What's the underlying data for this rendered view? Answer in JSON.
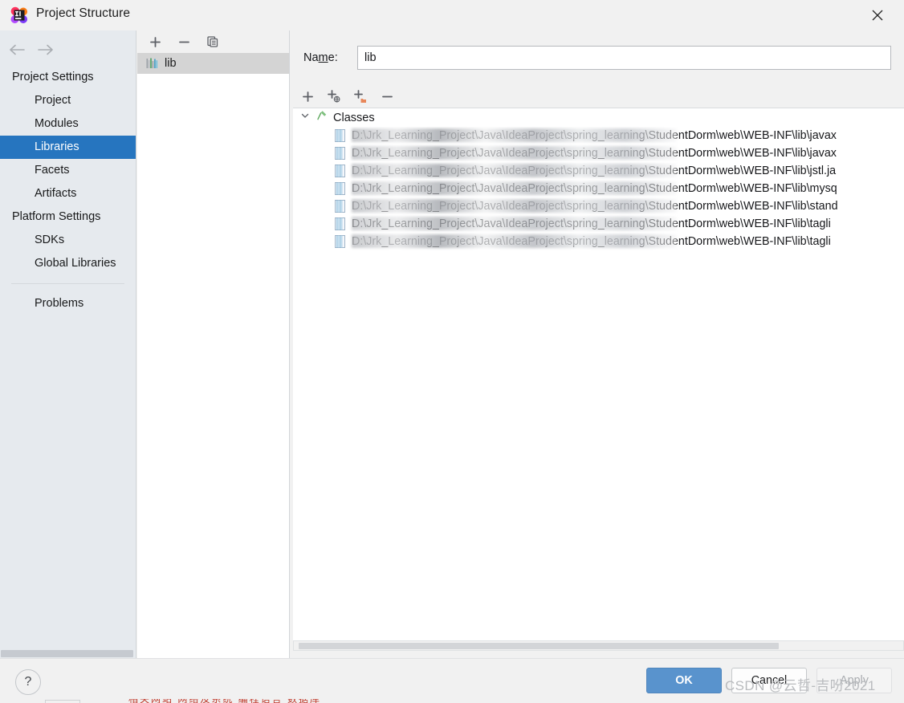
{
  "window": {
    "title": "Project Structure",
    "app_icon": "intellij-idea-logo",
    "close_icon": "close-icon"
  },
  "sidebar": {
    "back_icon": "arrow-left-icon",
    "forward_icon": "arrow-right-icon",
    "groups": [
      {
        "label": "Project Settings",
        "items": [
          {
            "label": "Project",
            "selected": false
          },
          {
            "label": "Modules",
            "selected": false
          },
          {
            "label": "Libraries",
            "selected": true
          },
          {
            "label": "Facets",
            "selected": false
          },
          {
            "label": "Artifacts",
            "selected": false
          }
        ]
      },
      {
        "label": "Platform Settings",
        "items": [
          {
            "label": "SDKs",
            "selected": false
          },
          {
            "label": "Global Libraries",
            "selected": false
          }
        ]
      }
    ],
    "problems": "Problems"
  },
  "libraries_panel": {
    "toolbar": [
      {
        "name": "add-library-button",
        "icon": "plus-icon",
        "label": "+"
      },
      {
        "name": "remove-library-button",
        "icon": "minus-icon",
        "label": "−"
      },
      {
        "name": "copy-library-button",
        "icon": "copy-icon",
        "label": ""
      }
    ],
    "items": [
      {
        "label": "lib",
        "icon": "library-icon",
        "selected": true
      }
    ]
  },
  "detail": {
    "name_label_pre": "Na",
    "name_label_mid": "m",
    "name_label_post": "e:",
    "name_value": "lib",
    "name_placeholder": "",
    "toolbar": [
      {
        "name": "add-classes-button",
        "icon": "plus-icon"
      },
      {
        "name": "attach-url-button",
        "icon": "plus-globe-icon"
      },
      {
        "name": "attach-directory-button",
        "icon": "plus-folder-icon"
      },
      {
        "name": "remove-classes-button",
        "icon": "minus-icon"
      }
    ],
    "tree": {
      "root_label": "Classes",
      "root_icon": "classes-hammer-icon",
      "expanded": true,
      "expander_icon": "chevron-down-icon",
      "entries": [
        {
          "icon": "jar-icon",
          "path": "D:\\Jrk_Learning_Project\\Java\\IdeaProject\\spring_learning\\StudentDorm\\web\\WEB-INF\\lib\\javax",
          "redacted_width": 405
        },
        {
          "icon": "jar-icon",
          "path": "D:\\Jrk_Learning_Project\\Java\\IdeaProject\\spring_learning\\StudentDorm\\web\\WEB-INF\\lib\\javax",
          "redacted_width": 405
        },
        {
          "icon": "jar-icon",
          "path": "D:\\Jrk_Learning_Project\\Java\\IdeaProject\\spring_learning\\StudentDorm\\web\\WEB-INF\\lib\\jstl.ja",
          "redacted_width": 405
        },
        {
          "icon": "jar-icon",
          "path": "D:\\Jrk_Learning_Project\\Java\\IdeaProject\\spring_learning\\StudentDorm\\web\\WEB-INF\\lib\\mysq",
          "redacted_width": 405
        },
        {
          "icon": "jar-icon",
          "path": "D:\\Jrk_Learning_Project\\Java\\IdeaProject\\spring_learning\\StudentDorm\\web\\WEB-INF\\lib\\stand",
          "redacted_width": 405
        },
        {
          "icon": "jar-icon",
          "path": "D:\\Jrk_Learning_Project\\Java\\IdeaProject\\spring_learning\\StudentDorm\\web\\WEB-INF\\lib\\tagli",
          "redacted_width": 405
        },
        {
          "icon": "jar-icon",
          "path": "D:\\Jrk_Learning_Project\\Java\\IdeaProject\\spring_learning\\StudentDorm\\web\\WEB-INF\\lib\\tagli",
          "redacted_width": 405
        }
      ]
    }
  },
  "footer": {
    "help_label": "?",
    "ok_label": "OK",
    "cancel_label": "Cancel",
    "apply_label": "Apply"
  },
  "watermark": "CSDN @云哲-吉吩2021",
  "bottom_bleed": "相关网站 网络及系统 编程语言 数据库",
  "colors": {
    "accent_selected": "#2675bf",
    "ok_button": "#5993cd",
    "dialog_bg": "#f1f1f1",
    "sidebar_bg": "#e6eaee",
    "list_bg": "#ffffff",
    "lib_row_selected": "#d4d4d4"
  }
}
